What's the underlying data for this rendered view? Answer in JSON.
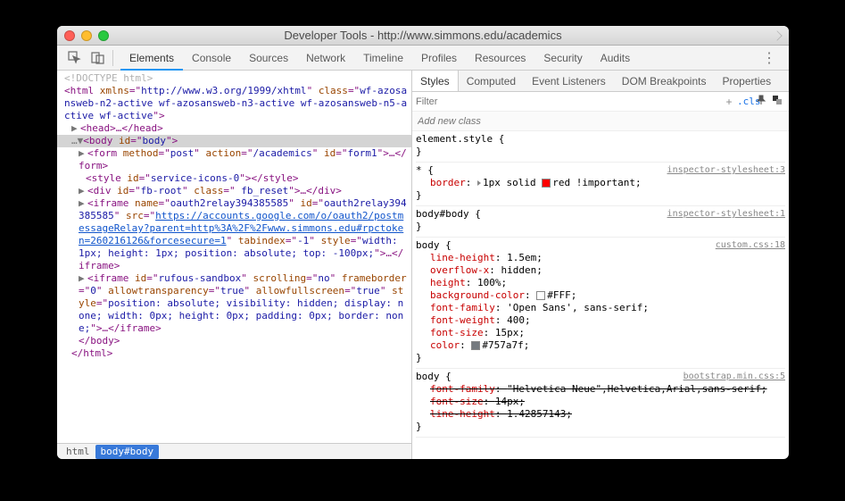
{
  "window": {
    "title": "Developer Tools - http://www.simmons.edu/academics"
  },
  "toolbar": {
    "tabs": [
      "Elements",
      "Console",
      "Sources",
      "Network",
      "Timeline",
      "Profiles",
      "Resources",
      "Security",
      "Audits"
    ],
    "active": 0
  },
  "dom": {
    "doctype": "<!DOCTYPE html>",
    "html_open": {
      "xmlns": "http://www.w3.org/1999/xhtml",
      "class": "wf-azosansweb-n2-active wf-azosansweb-n3-active wf-azosansweb-n5-active wf-active"
    },
    "head": "<head>…</head>",
    "body_id": "body",
    "form": {
      "method": "post",
      "action": "/academics",
      "id": "form1"
    },
    "style": {
      "id": "service-icons-0"
    },
    "div": {
      "id": "fb-root",
      "class": " fb_reset"
    },
    "iframe1": {
      "name": "oauth2relay394385585",
      "id": "oauth2relay394385585",
      "src": "https://accounts.google.com/o/oauth2/postmessageRelay?parent=http%3A%2F%2Fwww.simmons.edu#rpctoken=260216126&forcesecure=1",
      "tabindex": "-1",
      "style": "width: 1px; height: 1px; position: absolute; top: -100px;"
    },
    "iframe2": {
      "id": "rufous-sandbox",
      "scrolling": "no",
      "frameborder": "0",
      "allowtransparency": "true",
      "allowfullscreen": "true",
      "style": "position: absolute; visibility: hidden; display: none; width: 0px; height: 0px; padding: 0px; border: none;"
    },
    "body_close": "</body>",
    "html_close": "</html>"
  },
  "crumbs": [
    "html",
    "body#body"
  ],
  "styles": {
    "tabs": [
      "Styles",
      "Computed",
      "Event Listeners",
      "DOM Breakpoints",
      "Properties"
    ],
    "filter_placeholder": "Filter",
    "cls_label": ".cls",
    "addclass_placeholder": "Add new class",
    "rules": [
      {
        "selector": "element.style {",
        "props": [],
        "src": ""
      },
      {
        "selector": "* {",
        "src": "inspector-stylesheet:3",
        "props": [
          {
            "n": "border",
            "v": "1px solid ",
            "swatch": "colorred",
            "vtail": "red !important;"
          }
        ]
      },
      {
        "selector": "body#body {",
        "src": "inspector-stylesheet:1",
        "props": []
      },
      {
        "selector": "body {",
        "src": "custom.css:18",
        "props": [
          {
            "n": "line-height",
            "v": "1.5em;"
          },
          {
            "n": "overflow-x",
            "v": "hidden;"
          },
          {
            "n": "height",
            "v": "100%;"
          },
          {
            "n": "background-color",
            "v": "",
            "swatch": "colorwhite",
            "vtail": "#FFF;"
          },
          {
            "n": "font-family",
            "v": "'Open Sans', sans-serif;"
          },
          {
            "n": "font-weight",
            "v": "400;"
          },
          {
            "n": "font-size",
            "v": "15px;"
          },
          {
            "n": "color",
            "v": "",
            "swatch": "colorgray",
            "vtail": "#757a7f;"
          }
        ]
      },
      {
        "selector": "body {",
        "src": "bootstrap.min.css:5",
        "props": [
          {
            "n": "font-family",
            "v": "\"Helvetica Neue\",Helvetica,Arial,sans-serif;",
            "strike": true
          },
          {
            "n": "font-size",
            "v": "14px;",
            "strike": true
          },
          {
            "n": "line-height",
            "v": "1.42857143;",
            "strike": true
          }
        ]
      }
    ]
  }
}
